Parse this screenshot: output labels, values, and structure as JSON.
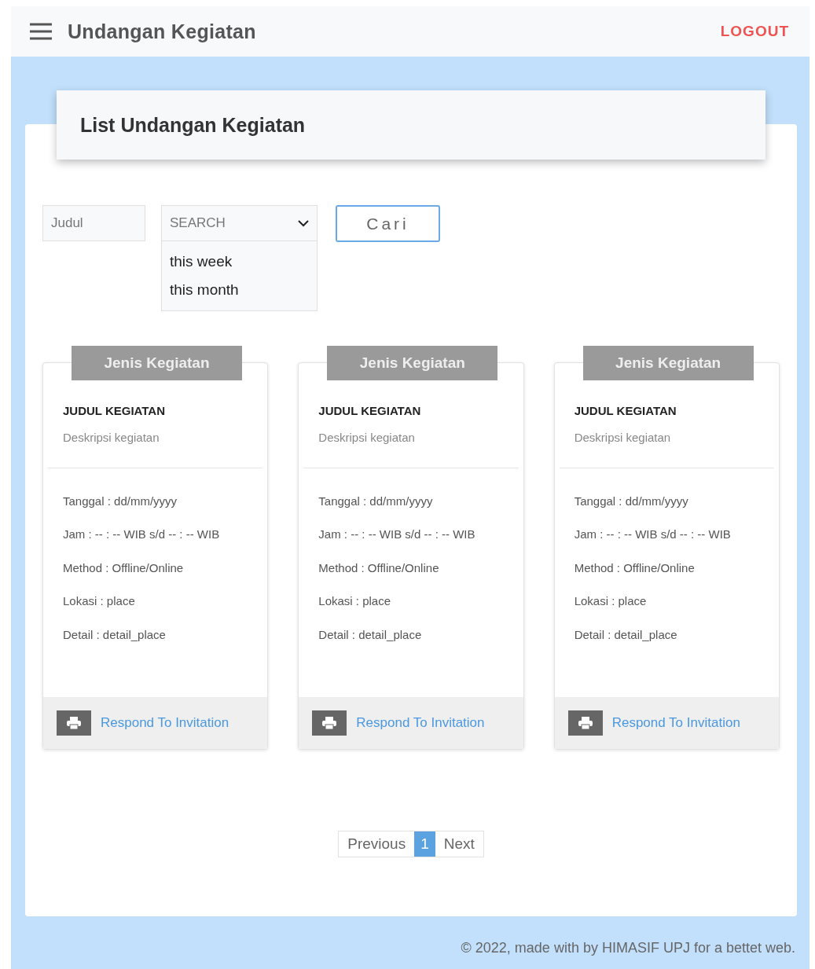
{
  "app_bar": {
    "title": "Undangan Kegiatan",
    "logout": "LOGOUT"
  },
  "page_title": "List Undangan Kegiatan",
  "filters": {
    "title_field": {
      "placeholder": "Judul"
    },
    "period_select": {
      "value": "SEARCH",
      "expanded": true,
      "options": [
        "this week",
        "this month"
      ]
    },
    "search_button": "Cari"
  },
  "cards": [
    {
      "category": "Jenis Kegiatan",
      "title": "JUDUL KEGIATAN",
      "description": "Deskripsi kegiatan",
      "details": [
        "Tanggal : dd/mm/yyyy",
        "Jam : -- : -- WIB s/d -- : -- WIB",
        "Method : Offline/Online",
        "Lokasi : place",
        "Detail : detail_place"
      ],
      "action": "Respond To Invitation"
    },
    {
      "category": "Jenis Kegiatan",
      "title": "JUDUL KEGIATAN",
      "description": "Deskripsi kegiatan",
      "details": [
        "Tanggal : dd/mm/yyyy",
        "Jam : -- : -- WIB s/d -- : -- WIB",
        "Method : Offline/Online",
        "Lokasi : place",
        "Detail : detail_place"
      ],
      "action": "Respond To Invitation"
    },
    {
      "category": "Jenis Kegiatan",
      "title": "JUDUL KEGIATAN",
      "description": "Deskripsi kegiatan",
      "details": [
        "Tanggal : dd/mm/yyyy",
        "Jam : -- : -- WIB s/d -- : -- WIB",
        "Method : Offline/Online",
        "Lokasi : place",
        "Detail : detail_place"
      ],
      "action": "Respond To Invitation"
    }
  ],
  "pagination": {
    "previous": "Previous",
    "pages": [
      {
        "label": "1",
        "selected": true
      }
    ],
    "next": "Next"
  },
  "footer": "© 2022, made with by HIMASIF UPJ for a bettet web."
}
